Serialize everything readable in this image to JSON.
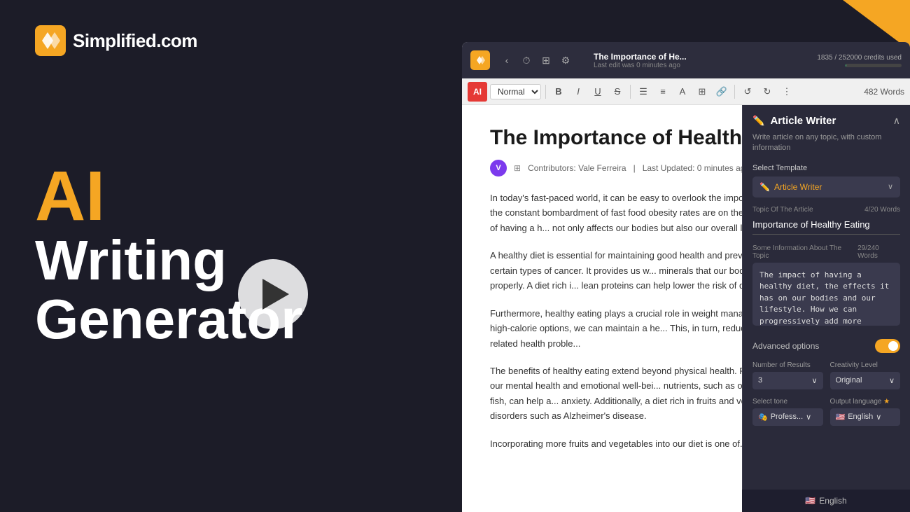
{
  "logo": {
    "text": "Simplified.com"
  },
  "hero": {
    "ai_label": "AI",
    "line1": "Writing",
    "line2": "Generator"
  },
  "app": {
    "toolbar": {
      "title": "The Importance of He...",
      "subtitle": "Last edit was 0 minutes ago",
      "credit_text": "1835 / 252000 credits used",
      "format_select": "Normal",
      "word_count": "482 Words"
    },
    "document": {
      "title": "The Importance of Healthy Eating",
      "meta_avatar": "V",
      "meta_contributors": "Contributors: Vale Ferreira",
      "meta_updated": "Last Updated: 0 minutes ago",
      "paragraphs": [
        "In today's fast-paced world, it can be easy to overlook the impo... our busy schedules and the constant bombardment of fast food obesity rates are on the rise. However, the impact of having a h... not only affects our bodies but also our overall lifestyle.",
        "A healthy diet is essential for maintaining good health and prev... disease, diabetes, and certain types of cancer. It provides us w... minerals that our bodies need to function properly. A diet rich i... lean proteins can help lower the risk of developing these disea...",
        "Furthermore, healthy eating plays a crucial role in weight mana... over processed and high-calorie options, we can maintain a he... This, in turn, reduces the risk of obesity-related health proble...",
        "The benefits of healthy eating extend beyond physical health. F... diet can also improve our mental health and emotional well-bei... nutrients, such as omega-3 fatty acids found in fish, can help a... anxiety. Additionally, a diet rich in fruits and vegetables has bee... mental disorders such as Alzheimer's disease.",
        "Incorporating more fruits and vegetables into our diet is one of..."
      ]
    },
    "panel": {
      "title": "Article Writer",
      "subtitle": "Write article on any topic, with custom information",
      "select_template_label": "Select Template",
      "selected_template": "Article Writer",
      "topic_label": "Topic Of The Article",
      "topic_word_count": "4/20 Words",
      "topic_value": "Importance of Healthy Eating",
      "info_label": "Some Information About The Topic",
      "info_word_count": "29/240 Words",
      "info_value": "The impact of having a healthy diet, the effects it has on our bodies and our lifestyle. How we can progressively add more fruits and vegetables in our diet.",
      "advanced_options_label": "Advanced options",
      "num_results_label": "Number of Results",
      "num_results_value": "3",
      "creativity_label": "Creativity Level",
      "creativity_value": "Original",
      "tone_label": "Select tone",
      "tone_value": "Profess...",
      "output_lang_label": "Output language",
      "output_lang_value": "English",
      "output_lang_crown": "★"
    }
  },
  "bottom_bar": {
    "language": "English"
  }
}
